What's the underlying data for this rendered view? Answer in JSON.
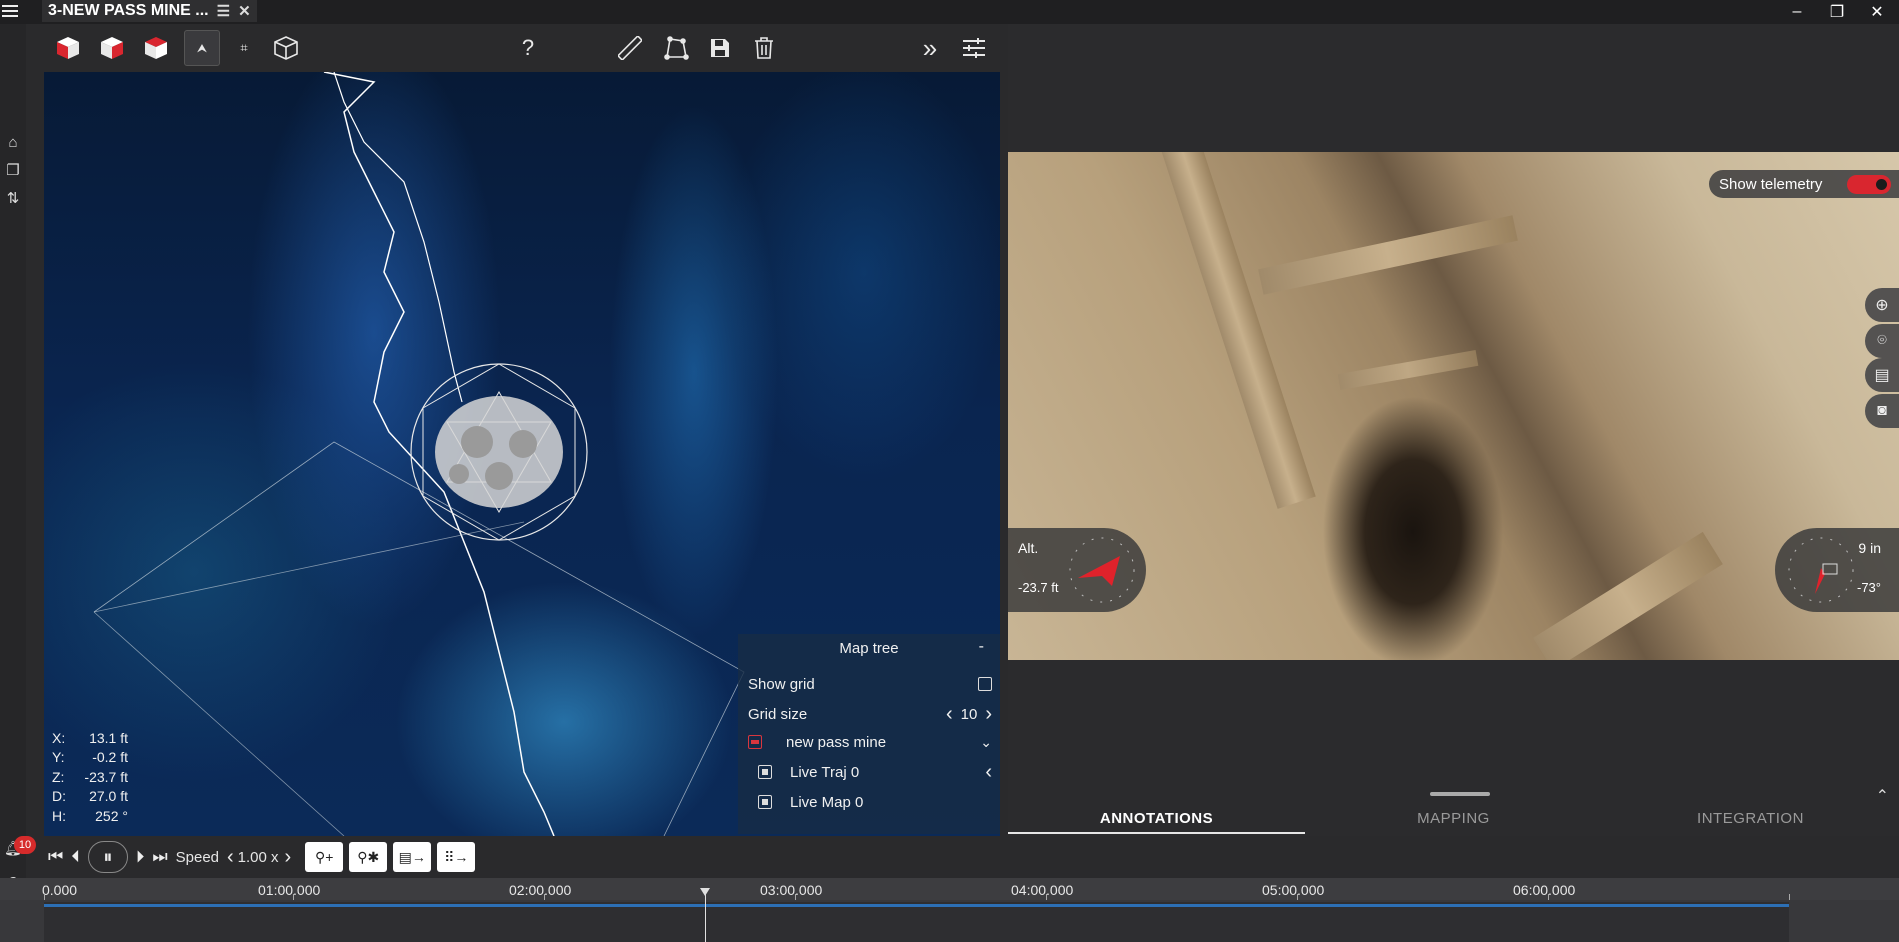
{
  "window": {
    "title": "3-NEW PASS MINE ...",
    "minimize": "–",
    "restore": "❐",
    "close": "✕"
  },
  "toolbar": {
    "help": "?"
  },
  "viewport": {
    "coords": [
      {
        "label": "X:",
        "value": "13.1 ft"
      },
      {
        "label": "Y:",
        "value": "-0.2 ft"
      },
      {
        "label": "Z:",
        "value": "-23.7 ft"
      },
      {
        "label": "D:",
        "value": "27.0 ft"
      },
      {
        "label": "H:",
        "value": "252 °"
      }
    ]
  },
  "map_tree": {
    "title": "Map tree",
    "minimize": "-",
    "show_grid_label": "Show grid",
    "grid_size_label": "Grid size",
    "grid_size_value": "10",
    "root_label": "new pass mine",
    "items": [
      {
        "label": "Live Traj 0"
      },
      {
        "label": "Live Map 0"
      }
    ]
  },
  "camera": {
    "telemetry_label": "Show telemetry",
    "altitude_label": "Alt.",
    "altitude_value": "-23.7 ft",
    "distance_value": "9 in",
    "angle_value": "-73°"
  },
  "panel_tabs": [
    "ANNOTATIONS",
    "MAPPING",
    "INTEGRATION"
  ],
  "playback": {
    "speed_label": "Speed",
    "speed_value": "1.00 x"
  },
  "timeline": {
    "labels": [
      "0.000",
      "01:00.000",
      "02:00.000",
      "03:00.000",
      "04:00.000",
      "05:00.000",
      "06:00.000"
    ]
  },
  "notifications": {
    "count": "10"
  },
  "colors": {
    "accent": "#d9262f",
    "timeline_blue": "#2c6fb5"
  }
}
